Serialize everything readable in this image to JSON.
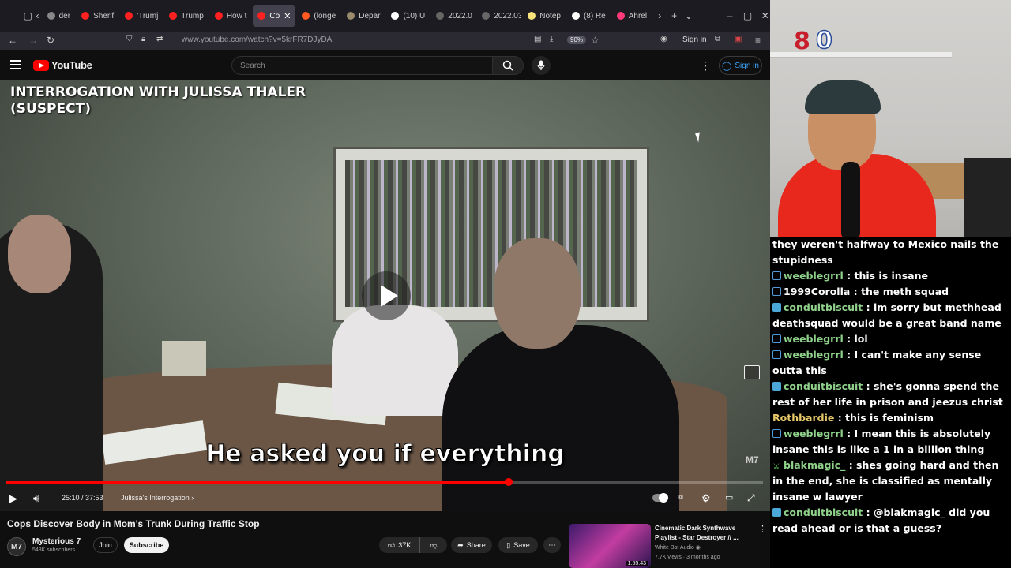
{
  "browser": {
    "tabs": [
      {
        "label": "der",
        "color": "#888"
      },
      {
        "label": "Sherif",
        "color": "#ff2020"
      },
      {
        "label": "'Trumj",
        "color": "#ff2020"
      },
      {
        "label": "Trump",
        "color": "#ff2020"
      },
      {
        "label": "How t",
        "color": "#ff2020"
      },
      {
        "label": "Co",
        "color": "#ff2020",
        "active": true
      },
      {
        "label": "(longe",
        "color": "#ff5a1f"
      },
      {
        "label": "Depar",
        "color": "#9a8b6a"
      },
      {
        "label": "(10) U",
        "color": "#ffffff"
      },
      {
        "label": "2022.0",
        "color": "#666"
      },
      {
        "label": "2022.03.1",
        "color": "#666"
      },
      {
        "label": "Notep",
        "color": "#f5e27a"
      },
      {
        "label": "(8) Re",
        "color": "#ffffff"
      },
      {
        "label": "Ahrel",
        "color": "#ff3a7a"
      }
    ],
    "url": "www.youtube.com/watch?v=5krFR7DJyDA",
    "zoom": "90%",
    "nav_signin": "Sign in"
  },
  "youtube": {
    "logo": "YouTube",
    "search_placeholder": "Search",
    "signin": "Sign in"
  },
  "player": {
    "overlay_title": "INTERROGATION WITH JULISSA THALER (SUSPECT)",
    "subtitle": "He asked you if everything",
    "watermark": "M7",
    "time": "25:10 / 37:53",
    "chapter": "Julissa's Interrogation",
    "progress_fraction": 0.664
  },
  "video": {
    "title": "Cops Discover Body in Mom's Trunk During Traffic Stop",
    "channel": "Mysterious 7",
    "subscribers": "548K subscribers",
    "avatar_text": "M7",
    "join": "Join",
    "subscribe": "Subscribe",
    "likes": "37K",
    "share": "Share",
    "save": "Save"
  },
  "recommended": {
    "title": "Cinematic Dark Synthwave Playlist - Star Destroyer // ...",
    "channel": "White Bat Audio",
    "meta": "7.7K views · 3 months ago",
    "duration": "1:55:43"
  },
  "stream": {
    "badge_icon": "8",
    "badge_count": "0"
  },
  "chat": [
    {
      "icon": "",
      "user": "",
      "user_color": "#ffffff",
      "text": "they weren't halfway to Mexico nails the stupidness"
    },
    {
      "icon": "person",
      "user": "weeblegrrl",
      "user_color": "#8fd18a",
      "text": " : this is insane"
    },
    {
      "icon": "person",
      "user": "1999Corolla",
      "user_color": "#ffffff",
      "text": " : the meth squad"
    },
    {
      "icon": "screen",
      "user": "conduitbiscuit",
      "user_color": "#8fd18a",
      "text": " : im sorry but methhead deathsquad would be a great band name"
    },
    {
      "icon": "person",
      "user": "weeblegrrl",
      "user_color": "#8fd18a",
      "text": " : lol"
    },
    {
      "icon": "person",
      "user": "weeblegrrl",
      "user_color": "#8fd18a",
      "text": " : I can't make any sense outta this"
    },
    {
      "icon": "screen",
      "user": "conduitbiscuit",
      "user_color": "#8fd18a",
      "text": " : she's gonna spend the rest of her life in prison and jeezus christ"
    },
    {
      "icon": "",
      "user": "Rothbardie",
      "user_color": "#e8c96a",
      "text": " : this is feminism"
    },
    {
      "icon": "person",
      "user": "weeblegrrl",
      "user_color": "#8fd18a",
      "text": " : I mean this is absolutely insane this is like a 1 in a billion thing"
    },
    {
      "icon": "sword",
      "user": "blakmagic_",
      "user_color": "#8fd18a",
      "text": " : shes going hard and then in the end, she is classified as mentally insane w lawyer"
    },
    {
      "icon": "screen",
      "user": "conduitbiscuit",
      "user_color": "#8fd18a",
      "text": " : @blakmagic_ did you read ahead or is that a guess?"
    }
  ]
}
